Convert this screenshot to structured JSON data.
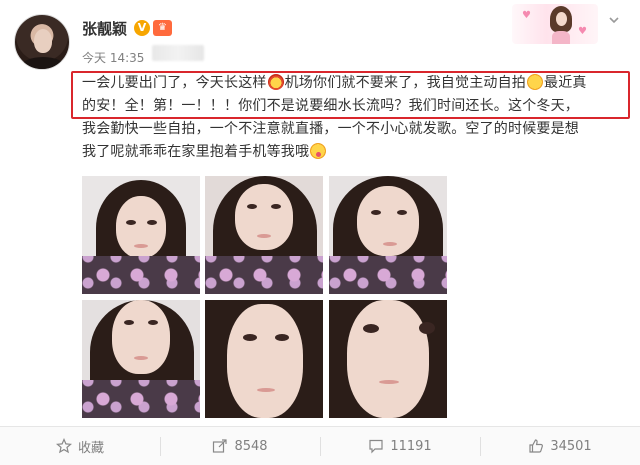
{
  "author": {
    "name": "张靓颖",
    "verify_badge": "V",
    "member_badge": "♛"
  },
  "post_meta": {
    "time": "今天 14:35"
  },
  "post": {
    "lines": [
      "一会儿要出门了，今天长这样",
      "机场你们就不要来了，我自觉主动自拍",
      "最近真",
      "的安！全！第！一！！！你们不是说要细水长流吗？我们时间还长。这个冬天，",
      "我会勤快一些自拍，一个不注意就直播，一个不小心就发歌。空了的时候要是想",
      "我了呢就乖乖在家里抱着手机等我哦"
    ]
  },
  "actions": {
    "favorite_label": "收藏",
    "repost_count": "8548",
    "comment_count": "11191",
    "like_count": "34501"
  },
  "colors": {
    "highlight_border": "#d9262c",
    "text": "#333333",
    "meta": "#808080"
  },
  "icons": {
    "favorite": "star-icon",
    "repost": "share-icon",
    "comment": "comment-icon",
    "like": "thumbs-up-icon",
    "menu": "chevron-down-icon"
  }
}
